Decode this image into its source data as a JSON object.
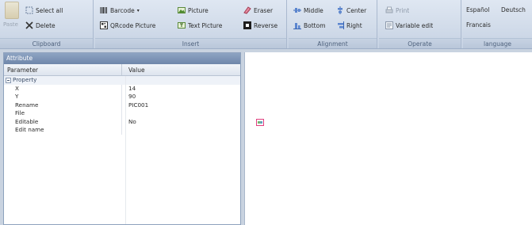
{
  "ribbon": {
    "clipboard": {
      "label": "Clipboard",
      "paste": "Paste",
      "select_all": "Select all",
      "delete": "Delete"
    },
    "insert": {
      "label": "Insert",
      "barcode": "Barcode",
      "qrcode_picture": "QRcode Picture",
      "picture": "Picture",
      "text_picture": "Text Picture",
      "eraser": "Eraser",
      "reverse": "Reverse"
    },
    "alignment": {
      "label": "Alignment",
      "middle": "Middle",
      "center": "Center",
      "bottom": "Bottom",
      "right": "Right"
    },
    "operate": {
      "label": "Operate",
      "print": "Print",
      "variable_edit": "Variable edit"
    },
    "language": {
      "label": "language",
      "espanol": "Español",
      "deutsch": "Deutsch",
      "francais": "Francais"
    }
  },
  "attribute_panel": {
    "title": "Attribute",
    "col_parameter": "Parameter",
    "col_value": "Value",
    "category": "Property",
    "rows": [
      {
        "name": "X",
        "value": "14"
      },
      {
        "name": "Y",
        "value": "90"
      },
      {
        "name": "Rename",
        "value": "PIC001"
      },
      {
        "name": "File",
        "value": ""
      },
      {
        "name": "Editable",
        "value": "No"
      },
      {
        "name": "Edit name",
        "value": ""
      }
    ]
  },
  "colors": {
    "ribbon_bg": "#d2dcea",
    "selection_border": "#e0407f"
  }
}
